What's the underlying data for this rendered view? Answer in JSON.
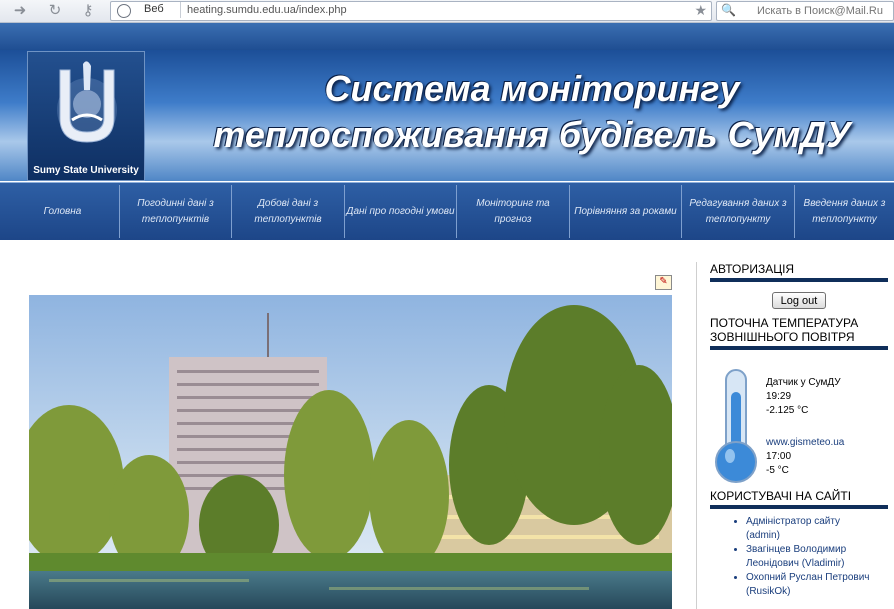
{
  "browser": {
    "url": "heating.sumdu.edu.ua/index.php",
    "search_engine_label": "Веб",
    "search_placeholder": "Искать в Поиск@Mail.Ru"
  },
  "site": {
    "logo_text": "Sumy State University",
    "title_line1": "Система моніторингу",
    "title_line2": "теплоспоживання будівель СумДУ"
  },
  "nav": {
    "items": [
      {
        "label": "Головна"
      },
      {
        "label": "Погодинні дані з теплопунктів"
      },
      {
        "label": "Добові дані з теплопунктів"
      },
      {
        "label": "Дані про погодні умови"
      },
      {
        "label": "Моніторинг та прогноз"
      },
      {
        "label": "Порівняння за роками"
      },
      {
        "label": "Редагування даних з теплопункту"
      },
      {
        "label": "Введення даних з теплопункту"
      }
    ]
  },
  "sidebar": {
    "auth_heading": "АВТОРИЗАЦІЯ",
    "logout_label": "Log out",
    "temp_heading": "ПОТОЧНА ТЕМПЕРАТУРА ЗОВНІШНЬОГО ПОВІТРЯ",
    "sensor": {
      "label": "Датчик у СумДУ",
      "time": "19:29",
      "value": "-2.125 °C"
    },
    "gismeteo": {
      "label": "www.gismeteo.ua",
      "time": "17:00",
      "value": "-5 °C"
    },
    "users_heading": "КОРИСТУВАЧІ НА САЙТІ",
    "users": [
      {
        "name": "Адміністратор сайту",
        "login": "(admin)"
      },
      {
        "name": "Звагінцев Володимир Леонідович",
        "login": "(Vladimir)"
      },
      {
        "name": "Охопний Руслан Петрович",
        "login": "(RusikOk)"
      }
    ]
  },
  "colors": {
    "nav_bg": "#1d4688",
    "header_dark": "#0f2e5a",
    "link": "#1a3e7d"
  }
}
